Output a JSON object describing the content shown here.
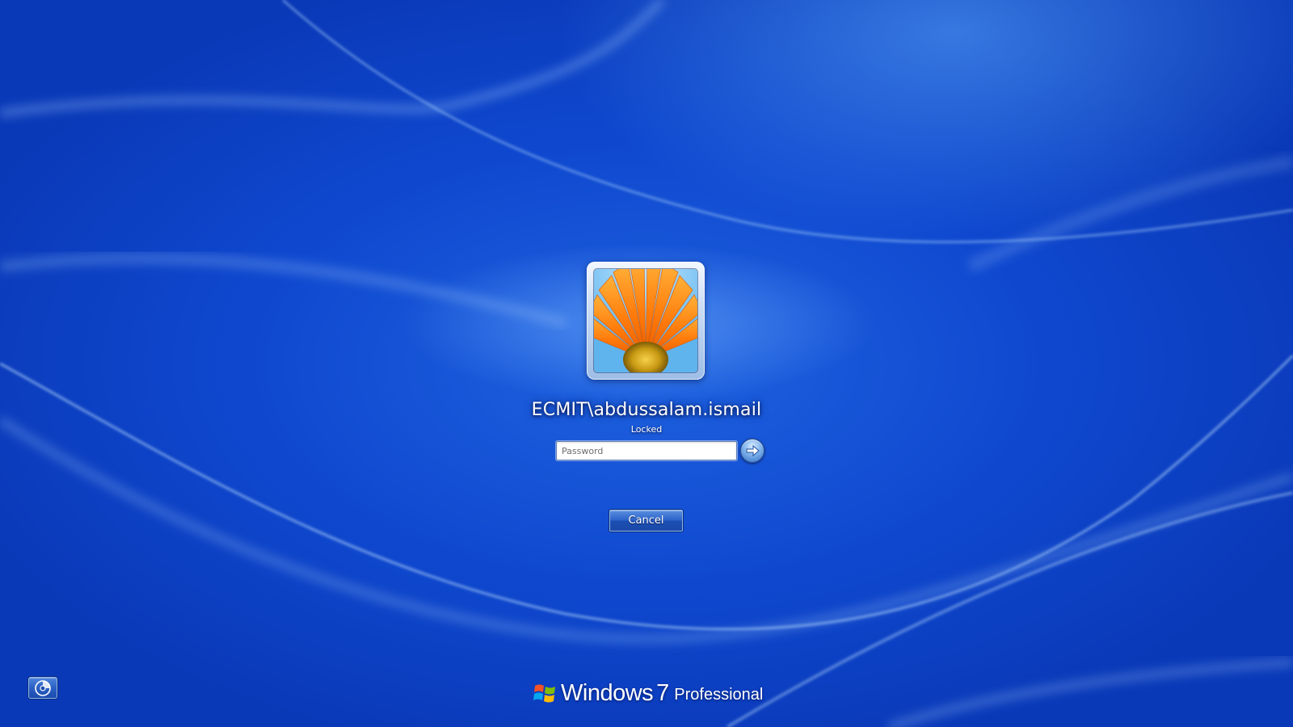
{
  "user": {
    "name": "ECMIT\\abdussalam.ismail",
    "status": "Locked",
    "avatar": "orange-gerbera-flower"
  },
  "login": {
    "password_placeholder": "Password",
    "password_value": "",
    "submit_icon": "arrow-right-icon",
    "cancel_label": "Cancel"
  },
  "accessibility": {
    "icon": "ease-of-access-icon"
  },
  "branding": {
    "word": "Windows",
    "version": "7",
    "edition": "Professional",
    "logo_icon": "windows-flag-icon"
  },
  "colors": {
    "background": "#0f48cf",
    "button": "#2c63c8",
    "text": "#ffffff"
  }
}
